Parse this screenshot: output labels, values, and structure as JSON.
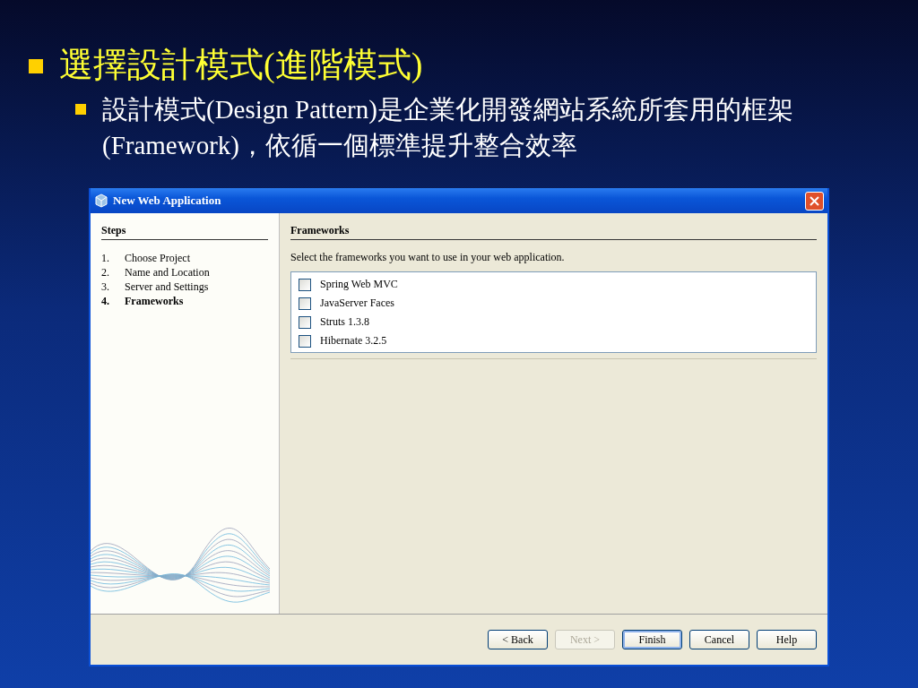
{
  "slide": {
    "title": "選擇設計模式(進階模式)",
    "bullet": "設計模式(Design Pattern)是企業化開發網站系統所套用的框架(Framework)，依循一個標準提升整合效率"
  },
  "dialog": {
    "title": "New Web Application",
    "steps_heading": "Steps",
    "steps": [
      {
        "number": "1.",
        "label": "Choose Project",
        "selected": false
      },
      {
        "number": "2.",
        "label": "Name and Location",
        "selected": false
      },
      {
        "number": "3.",
        "label": "Server and Settings",
        "selected": false
      },
      {
        "number": "4.",
        "label": "Frameworks",
        "selected": true
      }
    ],
    "panel_heading": "Frameworks",
    "instruction": "Select the frameworks you want to use in your web application.",
    "frameworks": [
      {
        "label": "Spring Web MVC",
        "checked": false
      },
      {
        "label": "JavaServer Faces",
        "checked": false
      },
      {
        "label": "Struts 1.3.8",
        "checked": false
      },
      {
        "label": "Hibernate 3.2.5",
        "checked": false
      }
    ],
    "buttons": [
      {
        "label": "< Back",
        "disabled": false,
        "default": false
      },
      {
        "label": "Next >",
        "disabled": true,
        "default": false
      },
      {
        "label": "Finish",
        "disabled": false,
        "default": true
      },
      {
        "label": "Cancel",
        "disabled": false,
        "default": false
      },
      {
        "label": "Help",
        "disabled": false,
        "default": false
      }
    ]
  }
}
